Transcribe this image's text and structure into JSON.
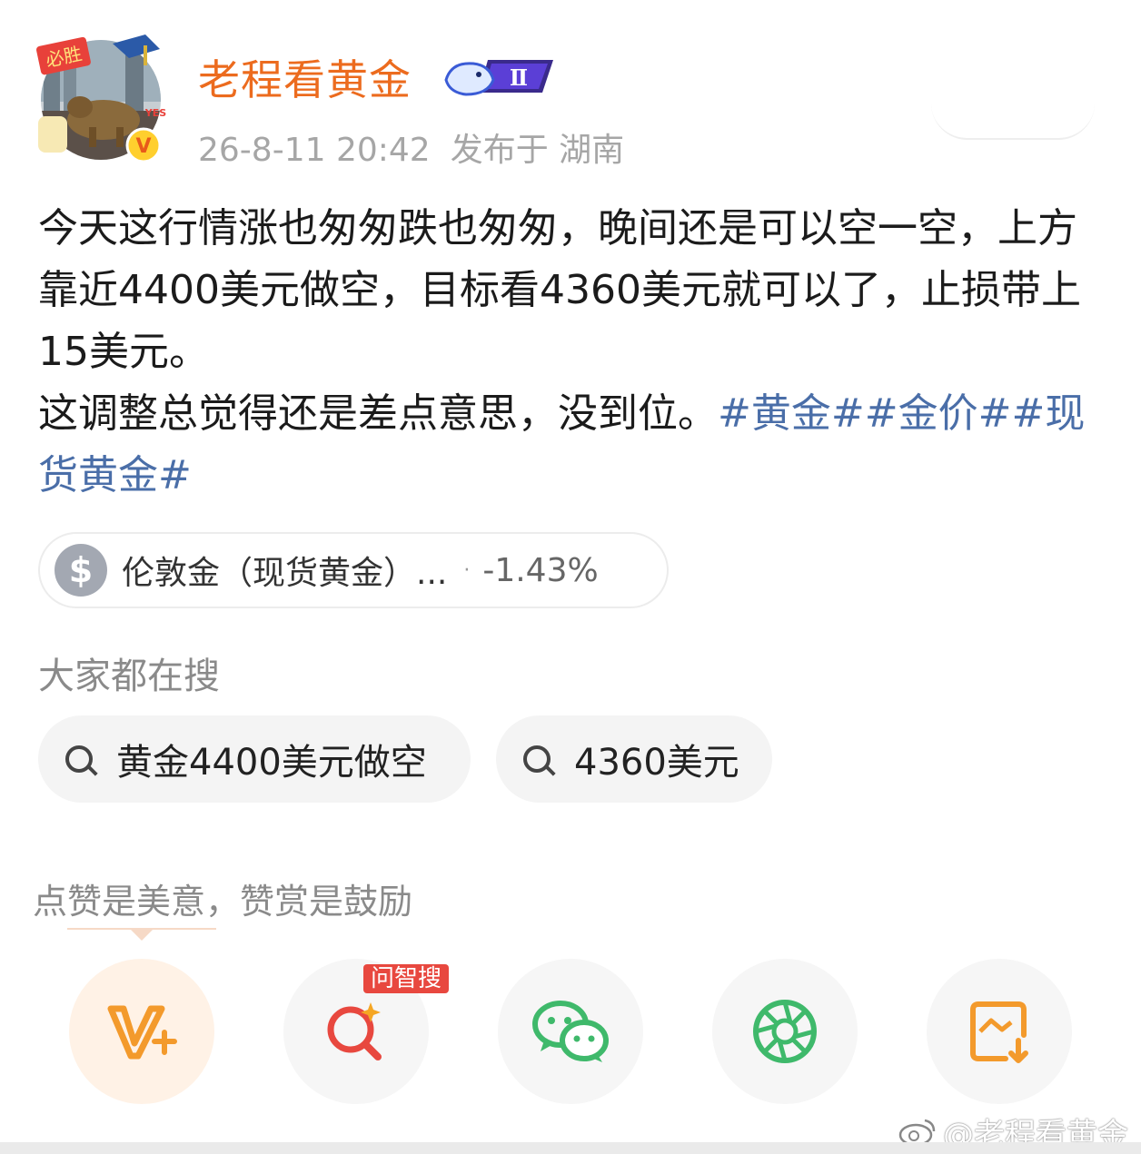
{
  "author": {
    "name": "老程看黄金",
    "level_badge": "Ⅱ",
    "avatar_badge_text": "必胜",
    "avatar_yes_text": "YES!",
    "verified_mark": "V"
  },
  "post_meta": {
    "date": "26-8-11 20:42",
    "location": "发布于 湖南"
  },
  "post": {
    "paragraph1": "今天这行情涨也匆匆跌也匆匆，晚间还是可以空一空，上方靠近4400美元做空，目标看4360美元就可以了，止损带上15美元。",
    "paragraph2_text": "这调整总觉得还是差点意思，没到位。",
    "hashtags": [
      "#黄金#",
      "#金价#",
      "#现货黄金#"
    ]
  },
  "stock": {
    "icon": "$",
    "name": "伦敦金（现货黄金）...",
    "dot": "·",
    "change": "-1.43%"
  },
  "searches": {
    "title": "大家都在搜",
    "items": [
      "黄金4400美元做空",
      "4360美元"
    ]
  },
  "reward_tip": "点赞是美意，赞赏是鼓励",
  "actions": [
    {
      "icon": "reward-v-icon",
      "color": "#f39a2c"
    },
    {
      "icon": "ask-search-icon",
      "color": "#e8483f",
      "badge": "问智搜"
    },
    {
      "icon": "wechat-icon",
      "color": "#3fb96b"
    },
    {
      "icon": "moments-icon",
      "color": "#3fb96b"
    },
    {
      "icon": "save-image-icon",
      "color": "#f39a2c"
    }
  ],
  "watermark": "@老程看黄金",
  "colors": {
    "username": "#ec6b1e",
    "hashtag": "#4a6ea8",
    "meta": "#a6a6a6"
  }
}
